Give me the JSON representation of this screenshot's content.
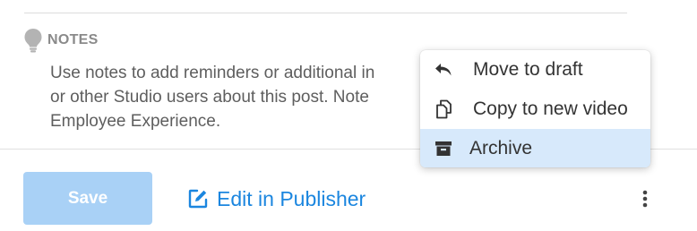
{
  "notes": {
    "title": "NOTES",
    "lines": [
      "Use notes to add reminders or additional in",
      "or other Studio users about this post. Note",
      "Employee Experience."
    ]
  },
  "actions": {
    "save_label": "Save",
    "edit_label": "Edit in Publisher"
  },
  "menu": {
    "items": [
      {
        "label": "Move to draft",
        "icon": "undo-arrow-icon"
      },
      {
        "label": "Copy to new video",
        "icon": "copy-icon"
      },
      {
        "label": "Archive",
        "icon": "archive-box-icon",
        "highlighted": true
      }
    ]
  },
  "colors": {
    "accent": "#1b86df",
    "save_disabled": "#a9d1f6",
    "menu_highlight": "#d7e9fb"
  }
}
